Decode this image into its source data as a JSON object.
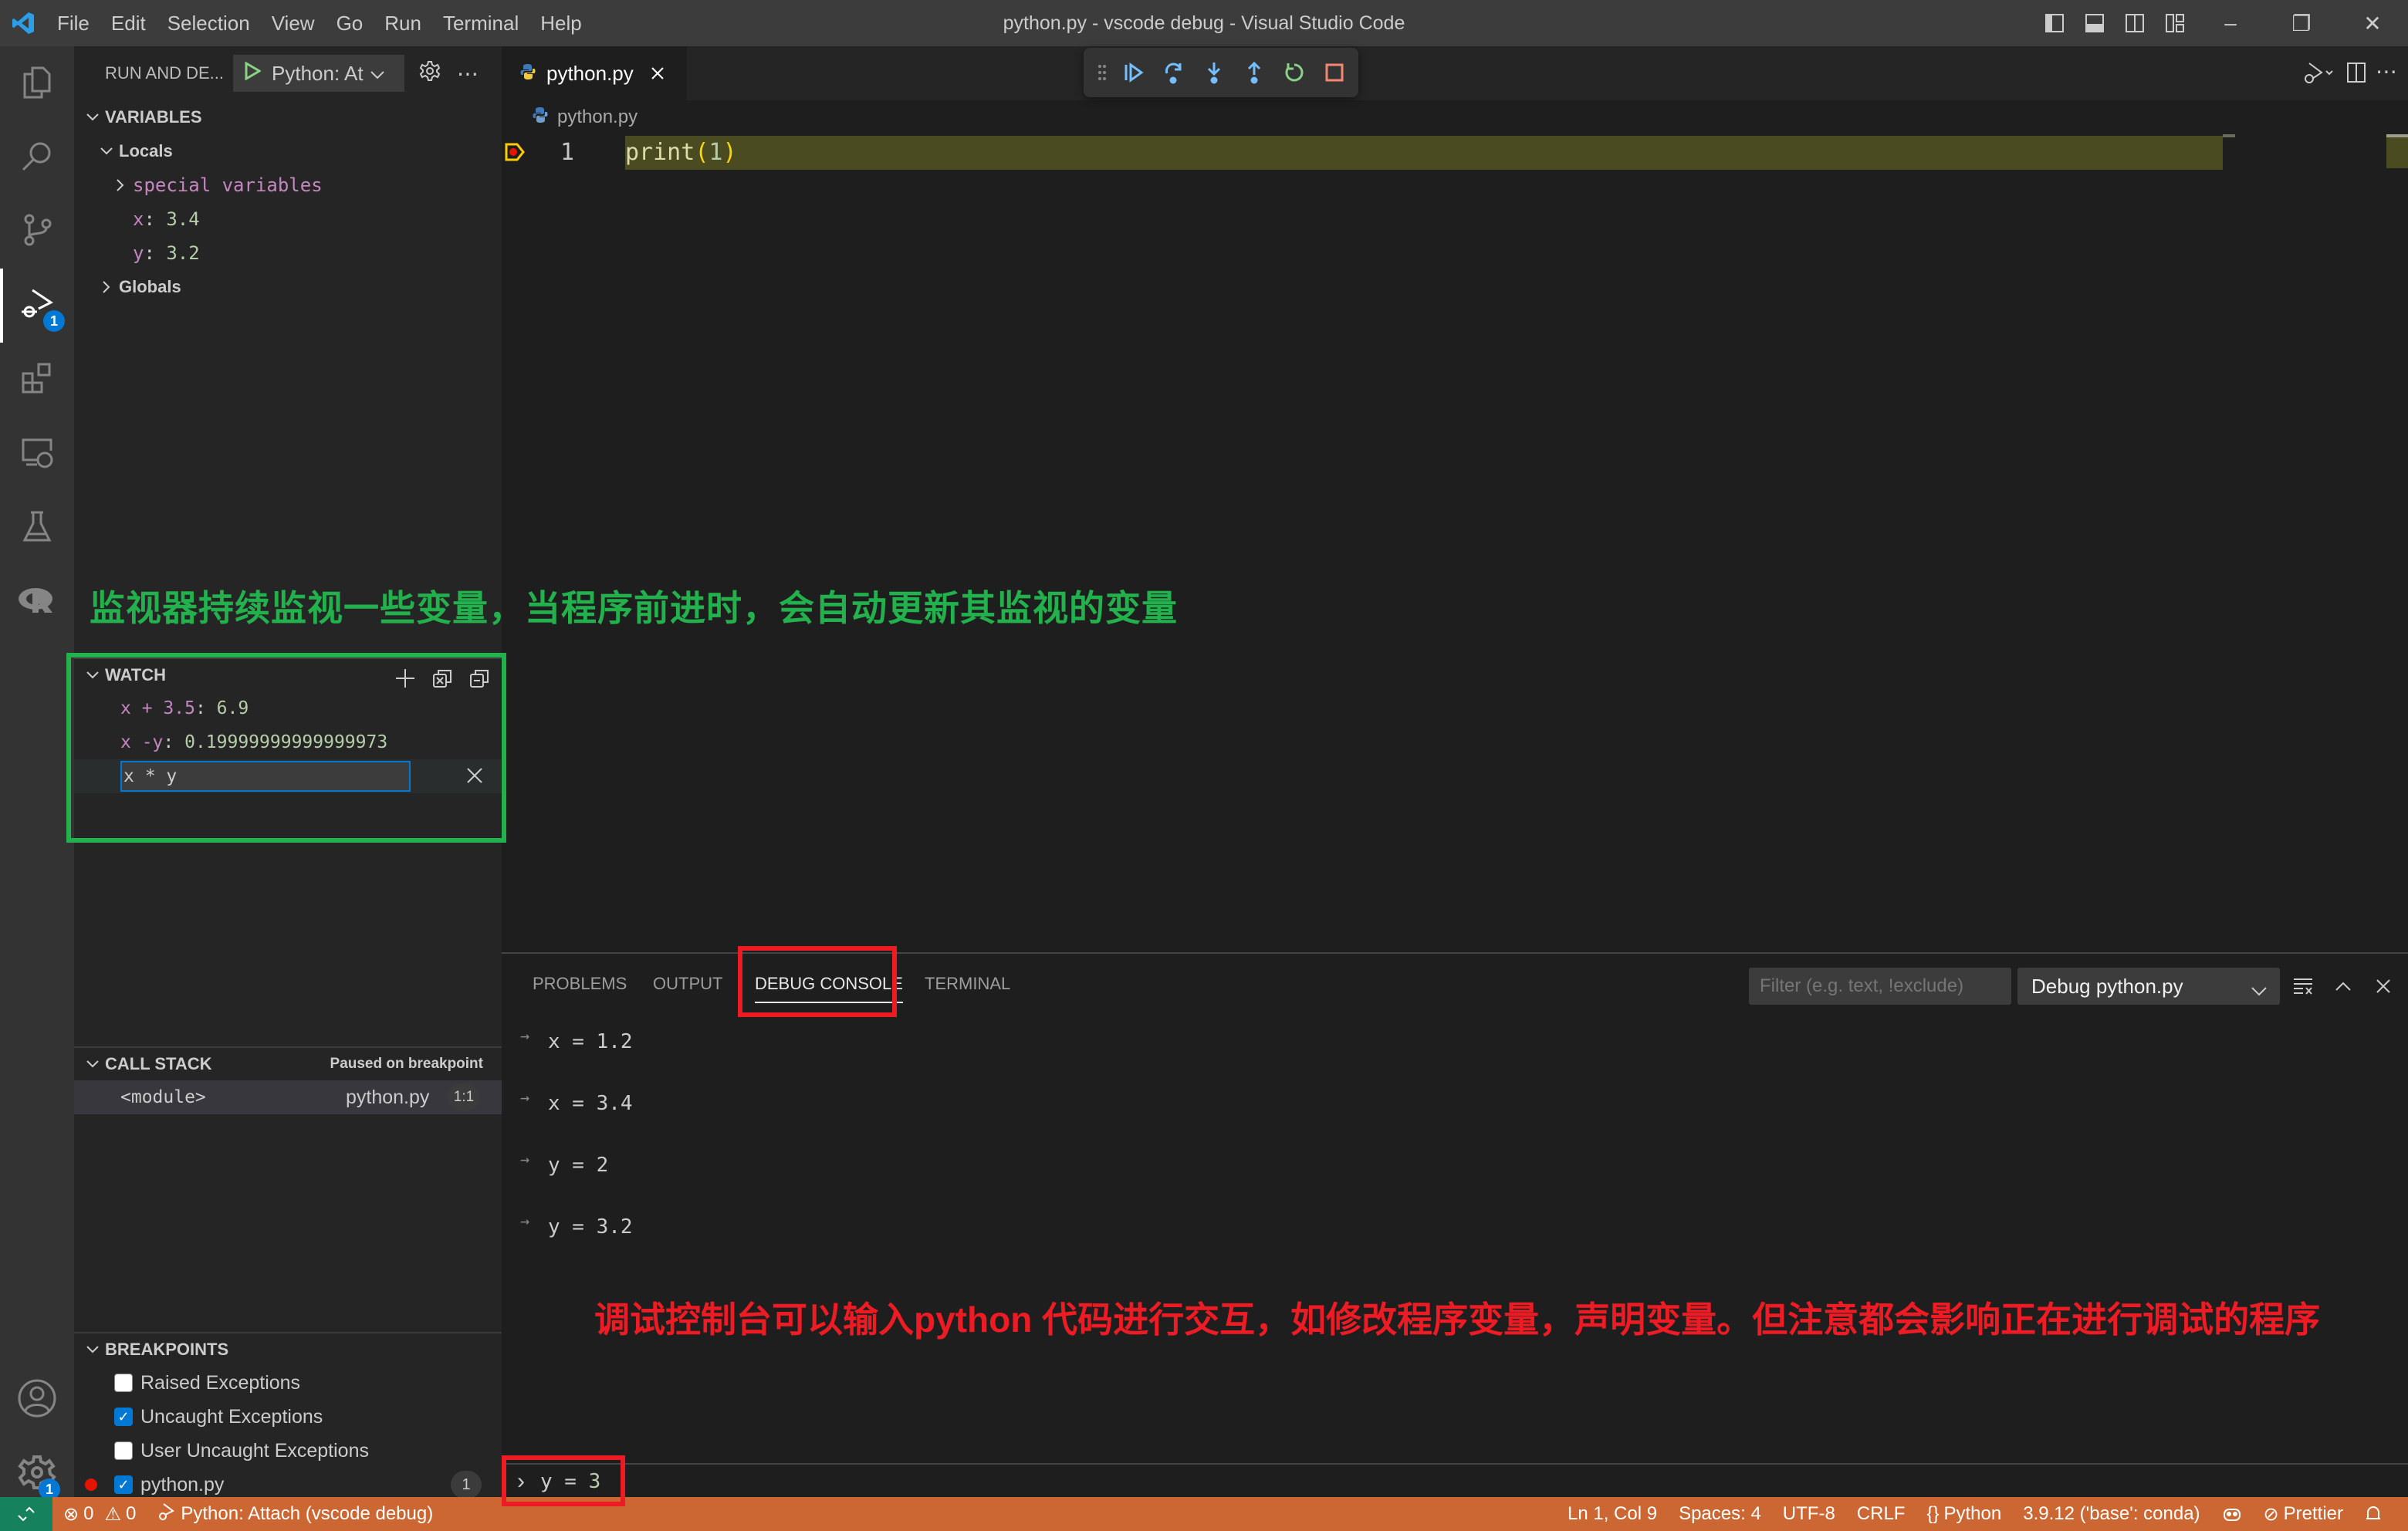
{
  "titlebar": {
    "menu": [
      "File",
      "Edit",
      "Selection",
      "View",
      "Go",
      "Run",
      "Terminal",
      "Help"
    ],
    "window_title": "python.py - vscode debug - Visual Studio Code",
    "window_buttons": {
      "minimize": "–",
      "restore": "❐",
      "close": "✕"
    }
  },
  "activitybar": {
    "items": [
      {
        "name": "explorer",
        "icon": "files-icon"
      },
      {
        "name": "search",
        "icon": "search-icon"
      },
      {
        "name": "source-control",
        "icon": "source-control-icon"
      },
      {
        "name": "run-and-debug",
        "icon": "debug-icon",
        "badge": "1",
        "active": true
      },
      {
        "name": "extensions",
        "icon": "extensions-icon"
      },
      {
        "name": "remote-explorer",
        "icon": "remote-explorer-icon"
      },
      {
        "name": "testing",
        "icon": "beaker-icon"
      },
      {
        "name": "r-language",
        "icon": "r-icon"
      }
    ],
    "bottom": [
      {
        "name": "accounts",
        "icon": "account-icon"
      },
      {
        "name": "manage",
        "icon": "gear-icon",
        "badge": "1"
      }
    ]
  },
  "sidebar": {
    "header": "RUN AND DE...",
    "launch_config": "Python: At",
    "variables": {
      "title": "VARIABLES",
      "scopes": [
        {
          "label": "Locals",
          "expanded": true
        },
        {
          "label": "Globals",
          "expanded": false
        }
      ],
      "special": "special variables",
      "locals": [
        {
          "name": "x",
          "value": "3.4"
        },
        {
          "name": "y",
          "value": "3.2"
        }
      ]
    },
    "watch": {
      "title": "WATCH",
      "items": [
        {
          "expr": "x + 3.5",
          "value": "6.9"
        },
        {
          "expr": "x -y",
          "value": "0.19999999999999973"
        }
      ],
      "editing_value": "x * y"
    },
    "callstack": {
      "title": "CALL STACK",
      "status": "Paused on breakpoint",
      "frames": [
        {
          "name": "<module>",
          "file": "python.py",
          "position": "1:1"
        }
      ]
    },
    "breakpoints": {
      "title": "BREAKPOINTS",
      "items": [
        {
          "label": "Raised Exceptions",
          "checked": false
        },
        {
          "label": "Uncaught Exceptions",
          "checked": true
        },
        {
          "label": "User Uncaught Exceptions",
          "checked": false
        },
        {
          "label": "python.py",
          "checked": true,
          "count": "1"
        }
      ]
    }
  },
  "editor": {
    "tab": "python.py",
    "breadcrumb": "python.py",
    "lines": [
      {
        "number": "1",
        "fn": "print",
        "open": "(",
        "arg": "1",
        "close": ")"
      }
    ]
  },
  "panel": {
    "tabs": [
      "PROBLEMS",
      "OUTPUT",
      "DEBUG CONSOLE",
      "TERMINAL"
    ],
    "active_tab": "DEBUG CONSOLE",
    "filter_placeholder": "Filter (e.g. text, !exclude)",
    "session": "Debug python.py",
    "console_lines": [
      "x = 1.2",
      "x = 3.4",
      "y = 2",
      "y = 3.2"
    ],
    "input_prompt": "›",
    "input_value_lhs": "y = ",
    "input_value_rhs": "3"
  },
  "statusbar": {
    "errors": "0",
    "warnings": "0",
    "debug_session": "Python: Attach (vscode debug)",
    "position": "Ln 1, Col 9",
    "spaces": "Spaces: 4",
    "encoding": "UTF-8",
    "eol": "CRLF",
    "language": "Python",
    "interpreter": "3.9.12 ('base': conda)",
    "prettier": "Prettier"
  },
  "annotations": {
    "watch_note": "监视器持续监视一些变量，当程序前进时，会自动更新其监视的变量",
    "console_note": "调试控制台可以输入python 代码进行交互，如修改程序变量，声明变量。但注意都会影响正在进行调试的程序"
  },
  "colors": {
    "statusbar_debug": "#cc6633",
    "annotation_green": "#22b14c",
    "annotation_red": "#ed1c24",
    "accent": "#0078d4"
  }
}
